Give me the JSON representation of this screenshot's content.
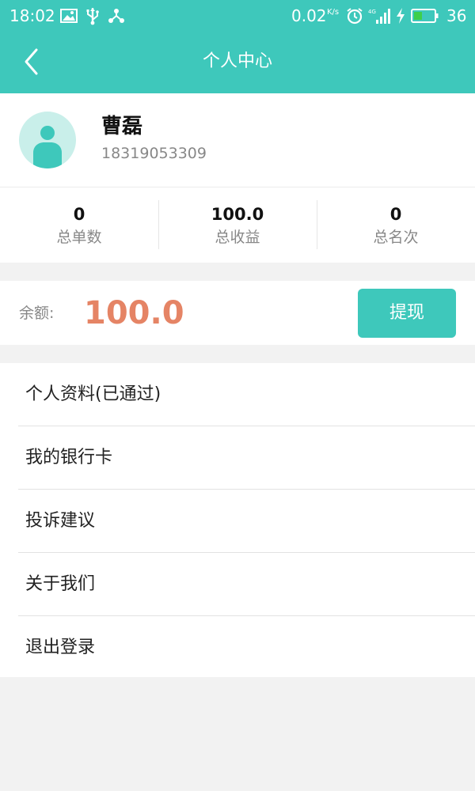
{
  "status_bar": {
    "time": "18:02",
    "network_speed": "0.02",
    "network_speed_unit": "K/s",
    "battery_level": "36",
    "icons": [
      "image-icon",
      "usb-icon",
      "share-icon",
      "alarm-icon",
      "signal-4g-icon",
      "charging-icon",
      "battery-icon"
    ]
  },
  "header": {
    "title": "个人中心",
    "back_icon": "chevron-left-icon"
  },
  "profile": {
    "name": "曹磊",
    "phone": "18319053309",
    "avatar_icon": "user-avatar-icon"
  },
  "stats": [
    {
      "value": "0",
      "label": "总单数"
    },
    {
      "value": "100.0",
      "label": "总收益"
    },
    {
      "value": "0",
      "label": "总名次"
    }
  ],
  "balance": {
    "label": "余额:",
    "value": "100.0",
    "withdraw_label": "提现"
  },
  "menu": {
    "items": [
      {
        "label": "个人资料(已通过)"
      },
      {
        "label": "我的银行卡"
      },
      {
        "label": "投诉建议"
      },
      {
        "label": "关于我们"
      },
      {
        "label": "退出登录"
      }
    ]
  },
  "colors": {
    "primary": "#3ec8bb",
    "balance_value": "#e58465",
    "page_background": "#f2f2f2",
    "avatar_background": "#c9efea"
  }
}
